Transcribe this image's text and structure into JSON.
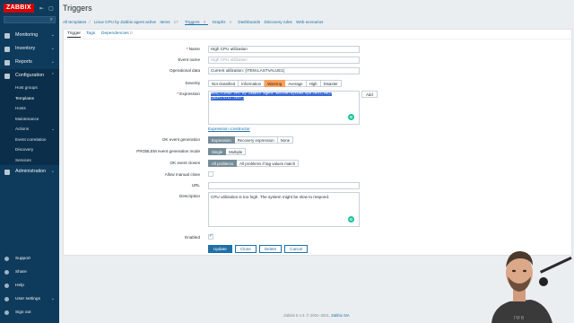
{
  "sidebar": {
    "brand": "ZABBIX",
    "menu": [
      {
        "label": "Monitoring",
        "icon": "eye-icon"
      },
      {
        "label": "Inventory",
        "icon": "list-icon"
      },
      {
        "label": "Reports",
        "icon": "chart-icon"
      },
      {
        "label": "Configuration",
        "icon": "wrench-icon"
      }
    ],
    "config_sub": [
      "Host groups",
      "Templates",
      "Hosts",
      "Maintenance",
      "Actions",
      "Event correlation",
      "Discovery",
      "Services"
    ],
    "admin": {
      "label": "Administration",
      "icon": "gear-icon"
    },
    "bottom": [
      {
        "label": "Support",
        "icon": "support-icon"
      },
      {
        "label": "Share",
        "icon": "share-icon"
      },
      {
        "label": "Help",
        "icon": "help-icon"
      },
      {
        "label": "User settings",
        "icon": "user-icon"
      },
      {
        "label": "Sign out",
        "icon": "power-icon"
      }
    ]
  },
  "page": {
    "title": "Triggers",
    "breadcrumb": {
      "all_templates": "All templates",
      "sep": "/",
      "template": "Linux CPU by Zabbix agent active",
      "items": "Items",
      "items_count": "17",
      "triggers": "Triggers",
      "triggers_count": "3",
      "graphs": "Graphs",
      "graphs_count": "4",
      "dashboards": "Dashboards",
      "discovery": "Discovery rules",
      "web": "Web scenarios"
    },
    "tabs": [
      "Trigger",
      "Tags",
      "Dependencies"
    ],
    "tab_dep_count": "0"
  },
  "form": {
    "name_label": "Name",
    "name_value": "High CPU utilization",
    "event_name_label": "Event name",
    "event_name_placeholder": "High CPU utilization",
    "opdata_label": "Operational data",
    "opdata_value": "Current utilization: {ITEM.LASTVALUE1}",
    "severity_label": "Severity",
    "severities": [
      "Not classified",
      "Information",
      "Warning",
      "Average",
      "High",
      "Disaster"
    ],
    "expression_label": "Expression",
    "expression_line1": "min(/Linux CPU by Zabbix agent active/system.cpu.util,5m)>",
    "expression_line2": "{$CPU.UTIL.CRIT}",
    "add_label": "Add",
    "expr_constructor": "Expression constructor",
    "ok_gen_label": "OK event generation",
    "ok_gen_options": [
      "Expression",
      "Recovery expression",
      "None"
    ],
    "problem_mode_label": "PROBLEM event generation mode",
    "problem_mode_options": [
      "Single",
      "Multiple"
    ],
    "ok_closes_label": "OK event closes",
    "ok_closes_options": [
      "All problems",
      "All problems if tag values match"
    ],
    "manual_close_label": "Allow manual close",
    "url_label": "URL",
    "description_label": "Description",
    "description_value": "CPU utilization is too high. The system might be slow to respond.",
    "enabled_label": "Enabled",
    "buttons": {
      "update": "Update",
      "clone": "Clone",
      "delete": "Delete",
      "cancel": "Cancel"
    }
  },
  "footer": {
    "text": "Zabbix 5.4.3. © 2001–2021,",
    "link": "Zabbix SIA"
  }
}
